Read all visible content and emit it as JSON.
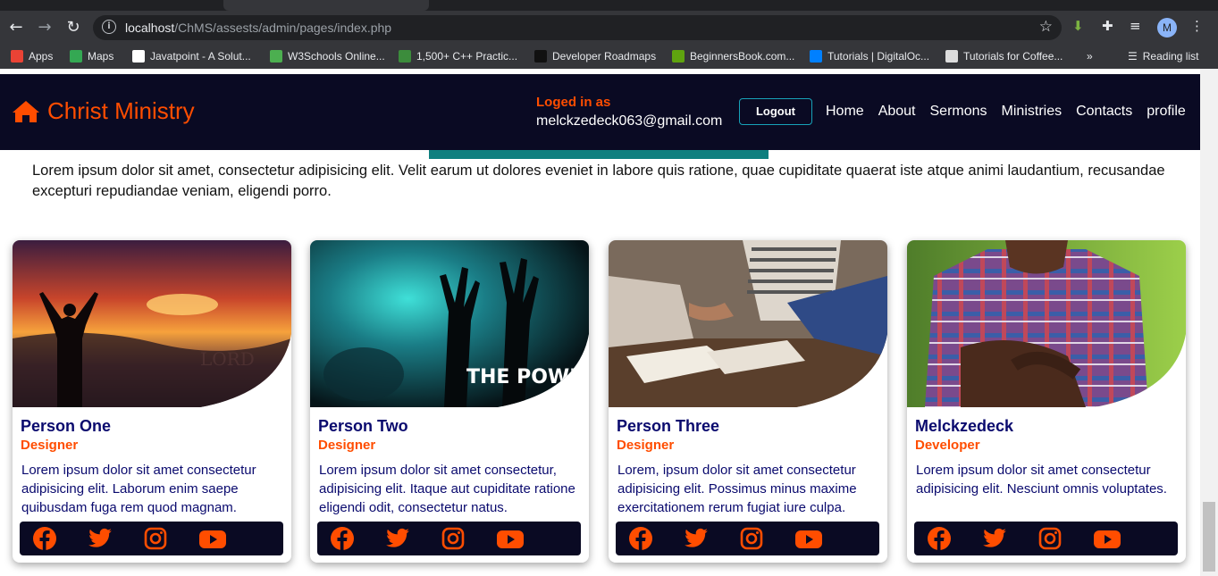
{
  "browser": {
    "url_host": "localhost",
    "url_path": "/ChMS/assests/admin/pages/index.php",
    "profile_initial": "M",
    "bookmarks": [
      {
        "label": "Apps",
        "color": "#ea4335"
      },
      {
        "label": "Maps",
        "color": "#34a853"
      },
      {
        "label": "Javatpoint - A Solut...",
        "color": "#ffffff"
      },
      {
        "label": "W3Schools Online...",
        "color": "#4caf50"
      },
      {
        "label": "1,500+ C++ Practic...",
        "color": "#3c8c3c"
      },
      {
        "label": "Developer Roadmaps",
        "color": "#111111"
      },
      {
        "label": "BeginnersBook.com...",
        "color": "#5fa30f"
      },
      {
        "label": "Tutorials | DigitalOc...",
        "color": "#0080ff"
      },
      {
        "label": "Tutorials for Coffee...",
        "color": "#dddddd"
      }
    ],
    "reading_list": "Reading list"
  },
  "header": {
    "brand": "Christ Ministry",
    "login_label": "Loged in as",
    "login_email": "melckzedeck063@gmail.com",
    "logout": "Logout",
    "nav": [
      "Home",
      "About",
      "Sermons",
      "Ministries",
      "Contacts",
      "profile"
    ]
  },
  "intro": "Lorem ipsum dolor sit amet, consectetur adipisicing elit. Velit earum ut dolores eveniet in labore quis ratione, quae cupiditate quaerat iste atque animi laudantium, recusandae excepturi repudiandae veniam, eligendi porro.",
  "cards": [
    {
      "name": "Person One",
      "role": "Designer",
      "desc": "Lorem ipsum dolor sit amet consectetur adipisicing elit. Laborum enim saepe quibusdam fuga rem quod magnam.",
      "image_text": "LORD"
    },
    {
      "name": "Person Two",
      "role": "Designer",
      "desc": "Lorem ipsum dolor sit amet consectetur, adipisicing elit. Itaque aut cupiditate ratione eligendi odit, consectetur natus.",
      "image_text": "THE POWER OF PRAISE"
    },
    {
      "name": "Person Three",
      "role": "Designer",
      "desc": "Lorem, ipsum dolor sit amet consectetur adipisicing elit. Possimus minus maxime exercitationem rerum fugiat iure culpa.",
      "image_text": ""
    },
    {
      "name": "Melckzedeck",
      "role": "Developer",
      "desc": "Lorem ipsum dolor sit amet consectetur adipisicing elit. Nesciunt omnis voluptates.",
      "image_text": ""
    }
  ],
  "colors": {
    "accent": "#ff4d00",
    "navy": "#0a0a23",
    "teal": "#0f7f7f"
  }
}
